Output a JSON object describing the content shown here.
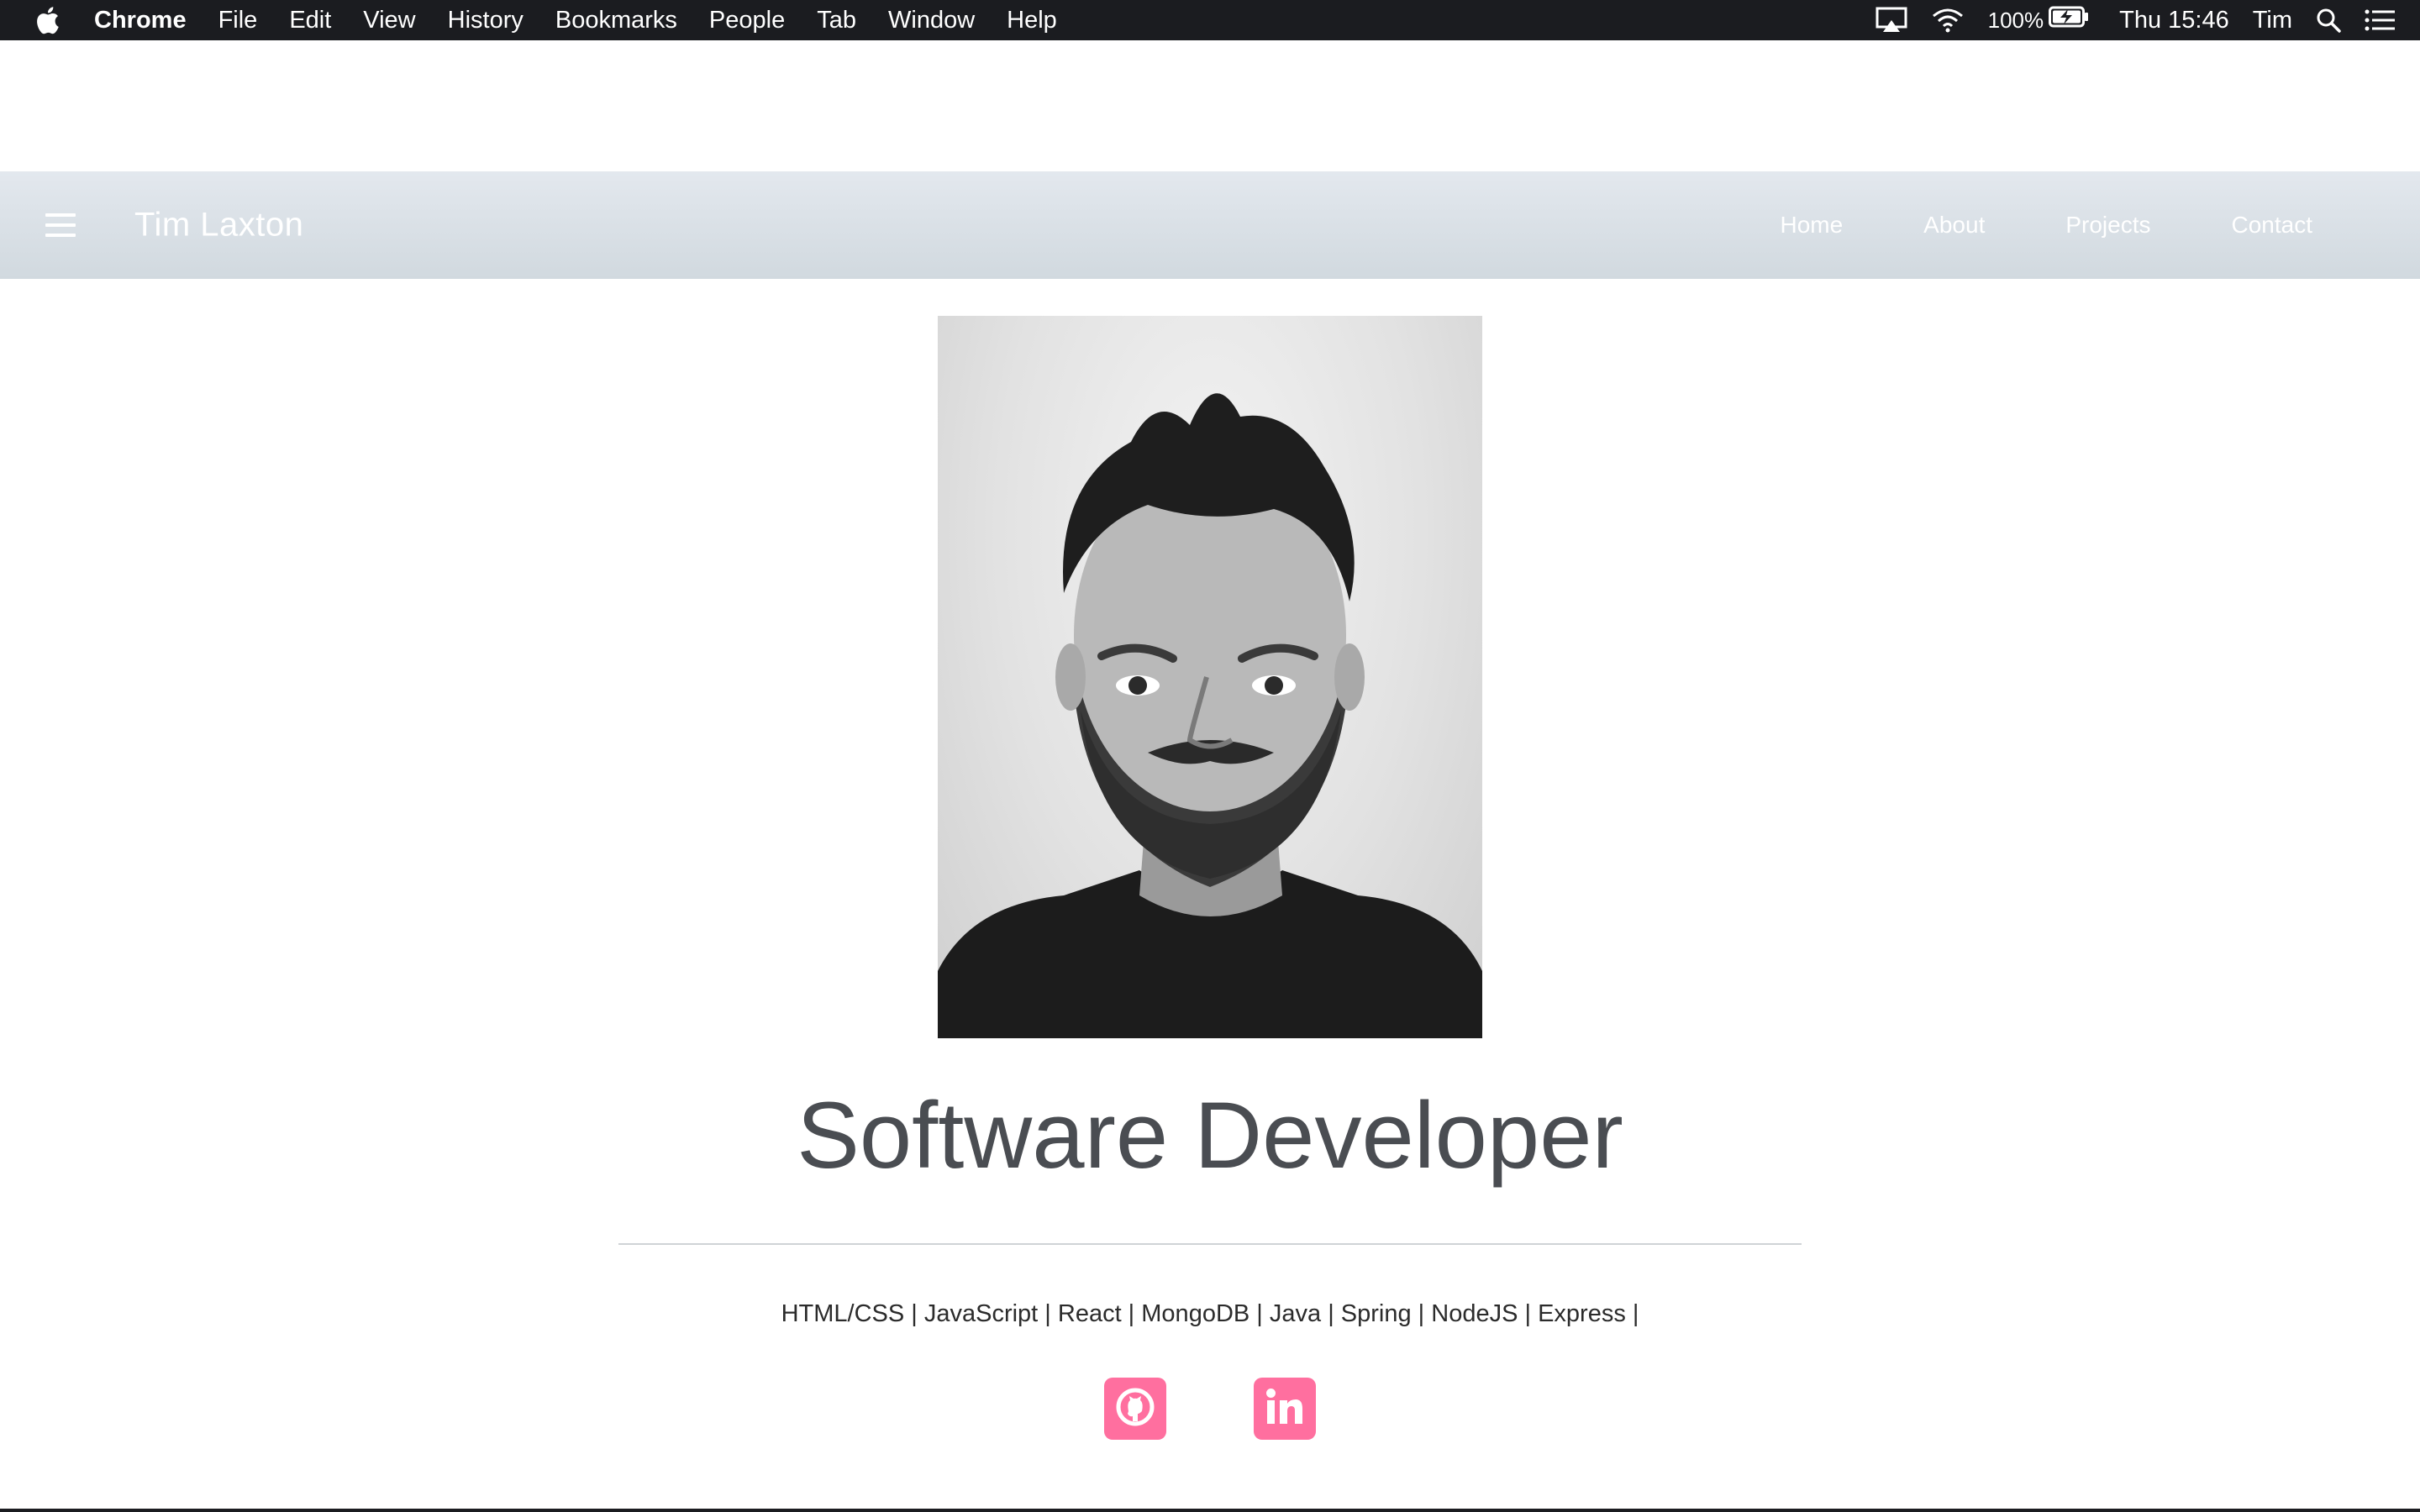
{
  "menubar": {
    "app_name": "Chrome",
    "items": [
      "File",
      "Edit",
      "View",
      "History",
      "Bookmarks",
      "People",
      "Tab",
      "Window",
      "Help"
    ],
    "battery": "100%",
    "clock": "Thu 15:46",
    "user": "Tim"
  },
  "site": {
    "brand": "Tim Laxton",
    "nav": [
      "Home",
      "About",
      "Projects",
      "Contact"
    ],
    "headline": "Software Developer",
    "skills": "HTML/CSS | JavaScript | React | MongoDB | Java | Spring | NodeJS | Express |",
    "social_icons": [
      "github-icon",
      "linkedin-icon"
    ]
  },
  "colors": {
    "accent": "#ff6f9f",
    "navbar": "#dde3e9",
    "headline": "#4a4d52"
  }
}
